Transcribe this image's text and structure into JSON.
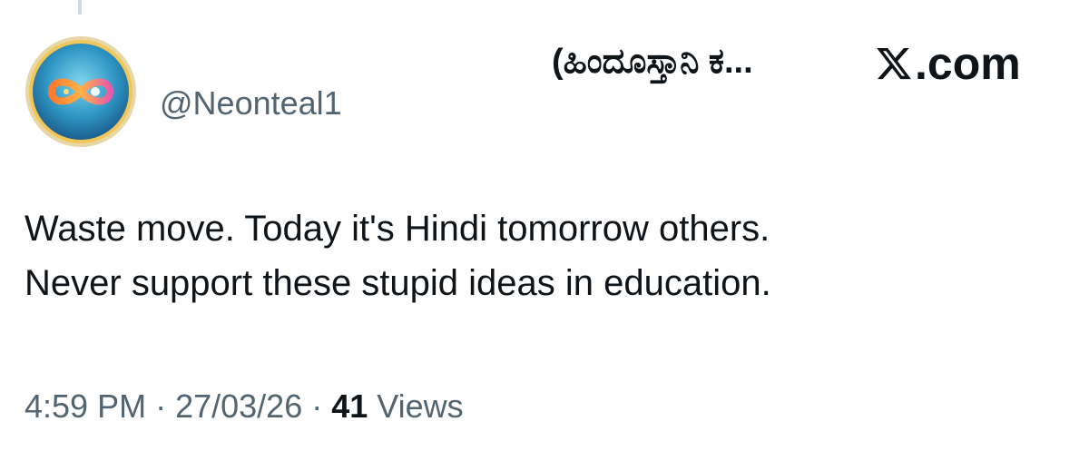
{
  "post": {
    "display_name": "(ಹಿಂದೂಸ್ತಾನಿ ಕ...",
    "handle": "@Neonteal1",
    "text_lines": [
      "Waste move. Today it's Hindi tomorrow others.",
      "Never support these stupid ideas in education."
    ],
    "time": "4:59 PM",
    "separator": " · ",
    "date": "27/03/26",
    "views_count": "41",
    "views_label": " Views"
  },
  "site": {
    "label": ".com"
  },
  "icons": {
    "avatar": "infinity-logo-avatar",
    "brand": "x-logo-icon"
  },
  "colors": {
    "text": "#0f1419",
    "secondary": "#536471",
    "avatar_ring": "#f2c75a",
    "avatar_bg": "#2a8fb8"
  }
}
